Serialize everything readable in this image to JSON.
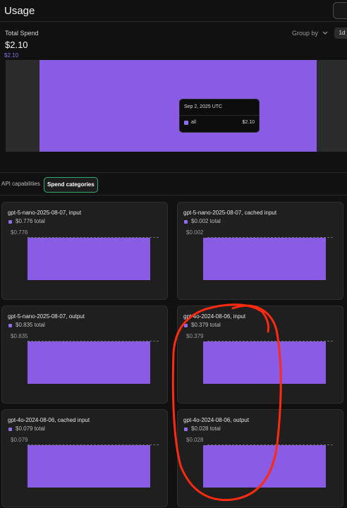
{
  "header": {
    "title": "Usage"
  },
  "summary": {
    "label": "Total Spend",
    "value": "$2.10",
    "axis_max_label": "$2.10",
    "group_by_label": "Group by",
    "period": "1d"
  },
  "chart_data": {
    "type": "bar",
    "categories": [
      "Sep 2, 2025 UTC"
    ],
    "series": [
      {
        "name": "all",
        "values": [
          2.1
        ]
      }
    ],
    "ylim": [
      0,
      2.1
    ]
  },
  "tooltip": {
    "date": "Sep 2, 2025 UTC",
    "series": "all",
    "value": "$2.10"
  },
  "tabs": [
    {
      "label": "API capabilities",
      "active": false
    },
    {
      "label": "Spend categories",
      "active": true
    }
  ],
  "cards": [
    {
      "title": "gpt-5-nano-2025-08-07, input",
      "total": "$0.776 total",
      "axis": "$0.776",
      "value": 0.776
    },
    {
      "title": "gpt-5-nano-2025-08-07, cached input",
      "total": "$0.002 total",
      "axis": "$0.002",
      "value": 0.002
    },
    {
      "title": "gpt-5-nano-2025-08-07, output",
      "total": "$0.835 total",
      "axis": "$0.835",
      "value": 0.835
    },
    {
      "title": "gpt-4o-2024-08-06, input",
      "total": "$0.379 total",
      "axis": "$0.379",
      "value": 0.379
    },
    {
      "title": "gpt-4o-2024-08-06, cached input",
      "total": "$0.079 total",
      "axis": "$0.079",
      "value": 0.079
    },
    {
      "title": "gpt-4o-2024-08-06, output",
      "total": "$0.028 total",
      "axis": "$0.028",
      "value": 0.028
    }
  ],
  "colors": {
    "accent": "#8a5ce6",
    "active_tab_border": "#2fae6d",
    "annotation": "#ff2a10"
  },
  "icons": {
    "group_by": "chevron-down-icon"
  }
}
